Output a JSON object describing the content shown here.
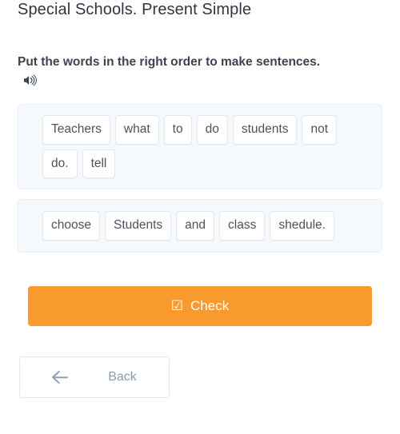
{
  "task": {
    "title": "Special Schools. Present Simple",
    "instruction": "Put the words in the right order to make sentences.",
    "speaker_icon": "speaker-sound-icon"
  },
  "word_banks": [
    {
      "id": "sentence-1",
      "words": [
        "Teachers",
        "what",
        "to",
        "do",
        "students",
        "not",
        "do.",
        "tell"
      ]
    },
    {
      "id": "sentence-2",
      "words": [
        "choose",
        "Students",
        "and",
        "class",
        "shedule."
      ]
    }
  ],
  "buttons": {
    "check": {
      "label": "Check",
      "icon": "checked-checkbox-icon",
      "icon_glyph": "☑",
      "color": "#f89a2d",
      "text_color": "#ffffff"
    },
    "back": {
      "label": "Back",
      "icon": "arrow-left-icon",
      "text_color": "#8d9ba8"
    }
  },
  "colors": {
    "accent": "#f89a2d",
    "bank_background": "#f5f8fc",
    "bank_border": "#e8eef4",
    "chip_background": "#ffffff",
    "chip_border": "#e2e8ee",
    "chip_text": "#4a525c",
    "title_text": "#2f3640",
    "instruction_text": "#3b4450"
  }
}
